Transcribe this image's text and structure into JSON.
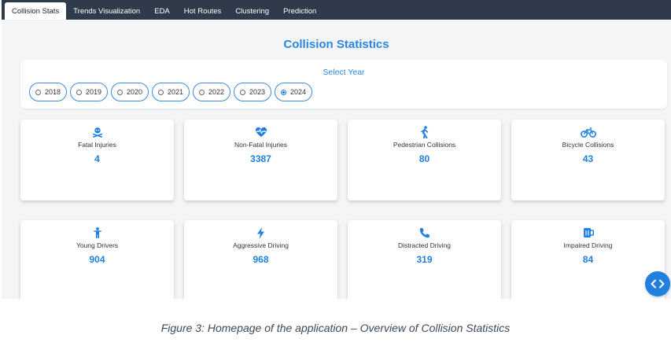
{
  "nav": {
    "tabs": [
      {
        "label": "Collision Stats",
        "active": true
      },
      {
        "label": "Trends Visualization",
        "active": false
      },
      {
        "label": "EDA",
        "active": false
      },
      {
        "label": "Hot Routes",
        "active": false
      },
      {
        "label": "Clustering",
        "active": false
      },
      {
        "label": "Prediction",
        "active": false
      }
    ]
  },
  "page": {
    "title": "Collision Statistics"
  },
  "year_selector": {
    "label": "Select Year",
    "options": [
      "2018",
      "2019",
      "2020",
      "2021",
      "2022",
      "2023",
      "2024"
    ],
    "selected": "2024"
  },
  "stats": [
    {
      "label": "Fatal Injuries",
      "value": "4",
      "icon": "skull-crossbones-icon"
    },
    {
      "label": "Non-Fatal Injuries",
      "value": "3387",
      "icon": "heart-pulse-icon"
    },
    {
      "label": "Pedestrian Collisions",
      "value": "80",
      "icon": "walking-person-icon"
    },
    {
      "label": "Bicycle Collisions",
      "value": "43",
      "icon": "bicycle-icon"
    },
    {
      "label": "Young Drivers",
      "value": "904",
      "icon": "child-icon"
    },
    {
      "label": "Aggressive Driving",
      "value": "968",
      "icon": "lightning-bolt-icon"
    },
    {
      "label": "Distracted Driving",
      "value": "319",
      "icon": "phone-icon"
    },
    {
      "label": "Impaired Driving",
      "value": "84",
      "icon": "beer-mug-icon"
    }
  ],
  "caption": "Figure 3: Homepage of the application – Overview of Collision Statistics",
  "colors": {
    "accent": "#1f80e0",
    "navbar": "#2f3b4a",
    "background": "#f4f5f7"
  }
}
